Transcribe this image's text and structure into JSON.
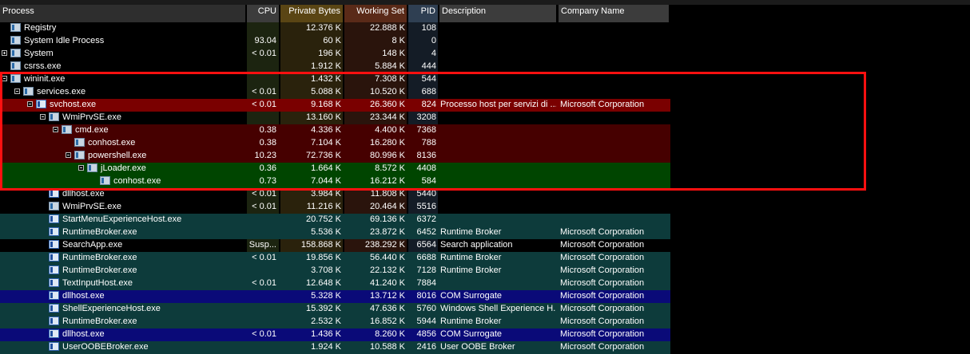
{
  "columns": {
    "process": "Process",
    "cpu": "CPU",
    "private_bytes": "Private Bytes",
    "working_set": "Working Set",
    "pid": "PID",
    "description": "Description",
    "company": "Company Name"
  },
  "colors": {
    "highlight_red": "#7a0000",
    "suspended_darkred": "#460000",
    "new_green": "#004500",
    "immersive_teal": "#0d3b3b",
    "service_blue": "#0a0a78",
    "selection_border": "#ff1010"
  },
  "rows": [
    {
      "name": "Registry",
      "cpu": "",
      "private_bytes": "12.376 K",
      "working_set": "22.888 K",
      "pid": "108",
      "description": "",
      "company": "",
      "depth": 0,
      "expander": "none",
      "bg": "none",
      "icon": "process-icon"
    },
    {
      "name": "System Idle Process",
      "cpu": "93.04",
      "private_bytes": "60 K",
      "working_set": "8 K",
      "pid": "0",
      "description": "",
      "company": "",
      "depth": 0,
      "expander": "none",
      "bg": "none",
      "icon": "process-icon"
    },
    {
      "name": "System",
      "cpu": "< 0.01",
      "private_bytes": "196 K",
      "working_set": "148 K",
      "pid": "4",
      "description": "",
      "company": "",
      "depth": 0,
      "expander": "plus",
      "bg": "none",
      "icon": "process-icon"
    },
    {
      "name": "csrss.exe",
      "cpu": "",
      "private_bytes": "1.912 K",
      "working_set": "5.884 K",
      "pid": "444",
      "description": "",
      "company": "",
      "depth": 0,
      "expander": "none",
      "bg": "none",
      "icon": "process-icon"
    },
    {
      "name": "wininit.exe",
      "cpu": "",
      "private_bytes": "1.432 K",
      "working_set": "7.308 K",
      "pid": "544",
      "description": "",
      "company": "",
      "depth": 0,
      "expander": "minus",
      "bg": "none",
      "icon": "process-icon"
    },
    {
      "name": "services.exe",
      "cpu": "< 0.01",
      "private_bytes": "5.088 K",
      "working_set": "10.520 K",
      "pid": "688",
      "description": "",
      "company": "",
      "depth": 1,
      "expander": "minus",
      "bg": "none",
      "icon": "process-icon"
    },
    {
      "name": "svchost.exe",
      "cpu": "< 0.01",
      "private_bytes": "9.168 K",
      "working_set": "26.360 K",
      "pid": "824",
      "description": "Processo host per servizi di ...",
      "company": "Microsoft Corporation",
      "depth": 2,
      "expander": "minus",
      "bg": "red",
      "icon": "service-icon"
    },
    {
      "name": "WmiPrvSE.exe",
      "cpu": "",
      "private_bytes": "13.160 K",
      "working_set": "23.344 K",
      "pid": "3208",
      "description": "",
      "company": "",
      "depth": 3,
      "expander": "minus",
      "bg": "none",
      "icon": "process-icon"
    },
    {
      "name": "cmd.exe",
      "cpu": "0.38",
      "private_bytes": "4.336 K",
      "working_set": "4.400 K",
      "pid": "7368",
      "description": "",
      "company": "",
      "depth": 4,
      "expander": "minus",
      "bg": "darkred",
      "icon": "process-icon"
    },
    {
      "name": "conhost.exe",
      "cpu": "0.38",
      "private_bytes": "7.104 K",
      "working_set": "16.280 K",
      "pid": "788",
      "description": "",
      "company": "",
      "depth": 5,
      "expander": "none",
      "bg": "darkred",
      "icon": "process-icon"
    },
    {
      "name": "powershell.exe",
      "cpu": "10.23",
      "private_bytes": "72.736 K",
      "working_set": "80.996 K",
      "pid": "8136",
      "description": "",
      "company": "",
      "depth": 5,
      "expander": "minus",
      "bg": "darkred",
      "icon": "process-icon"
    },
    {
      "name": "jLoader.exe",
      "cpu": "0.36",
      "private_bytes": "1.664 K",
      "working_set": "8.572 K",
      "pid": "4408",
      "description": "",
      "company": "",
      "depth": 6,
      "expander": "minus",
      "bg": "green",
      "icon": "process-icon"
    },
    {
      "name": "conhost.exe",
      "cpu": "0.73",
      "private_bytes": "7.044 K",
      "working_set": "16.212 K",
      "pid": "584",
      "description": "",
      "company": "",
      "depth": 7,
      "expander": "none",
      "bg": "green",
      "icon": "process-icon"
    },
    {
      "name": "dllhost.exe",
      "cpu": "< 0.01",
      "private_bytes": "3.984 K",
      "working_set": "11.808 K",
      "pid": "5440",
      "description": "",
      "company": "",
      "depth": 3,
      "expander": "none",
      "bg": "none",
      "icon": "service-icon"
    },
    {
      "name": "WmiPrvSE.exe",
      "cpu": "< 0.01",
      "private_bytes": "11.216 K",
      "working_set": "20.464 K",
      "pid": "5516",
      "description": "",
      "company": "",
      "depth": 3,
      "expander": "none",
      "bg": "none",
      "icon": "process-icon"
    },
    {
      "name": "StartMenuExperienceHost.exe",
      "cpu": "",
      "private_bytes": "20.752 K",
      "working_set": "69.136 K",
      "pid": "6372",
      "description": "",
      "company": "",
      "depth": 3,
      "expander": "none",
      "bg": "teal",
      "icon": "service-icon"
    },
    {
      "name": "RuntimeBroker.exe",
      "cpu": "",
      "private_bytes": "5.536 K",
      "working_set": "23.872 K",
      "pid": "6452",
      "description": "Runtime Broker",
      "company": "Microsoft Corporation",
      "depth": 3,
      "expander": "none",
      "bg": "teal",
      "icon": "service-icon"
    },
    {
      "name": "SearchApp.exe",
      "cpu": "Susp...",
      "private_bytes": "158.868 K",
      "working_set": "238.292 K",
      "pid": "6564",
      "description": "Search application",
      "company": "Microsoft Corporation",
      "depth": 3,
      "expander": "none",
      "bg": "none",
      "icon": "service-icon"
    },
    {
      "name": "RuntimeBroker.exe",
      "cpu": "< 0.01",
      "private_bytes": "19.856 K",
      "working_set": "56.440 K",
      "pid": "6688",
      "description": "Runtime Broker",
      "company": "Microsoft Corporation",
      "depth": 3,
      "expander": "none",
      "bg": "teal",
      "icon": "service-icon"
    },
    {
      "name": "RuntimeBroker.exe",
      "cpu": "",
      "private_bytes": "3.708 K",
      "working_set": "22.132 K",
      "pid": "7128",
      "description": "Runtime Broker",
      "company": "Microsoft Corporation",
      "depth": 3,
      "expander": "none",
      "bg": "teal",
      "icon": "service-icon"
    },
    {
      "name": "TextInputHost.exe",
      "cpu": "< 0.01",
      "private_bytes": "12.648 K",
      "working_set": "41.240 K",
      "pid": "7884",
      "description": "",
      "company": "Microsoft Corporation",
      "depth": 3,
      "expander": "none",
      "bg": "teal",
      "icon": "service-icon"
    },
    {
      "name": "dllhost.exe",
      "cpu": "",
      "private_bytes": "5.328 K",
      "working_set": "13.712 K",
      "pid": "8016",
      "description": "COM Surrogate",
      "company": "Microsoft Corporation",
      "depth": 3,
      "expander": "none",
      "bg": "blue",
      "icon": "service-icon"
    },
    {
      "name": "ShellExperienceHost.exe",
      "cpu": "",
      "private_bytes": "15.392 K",
      "working_set": "47.636 K",
      "pid": "5760",
      "description": "Windows Shell Experience H...",
      "company": "Microsoft Corporation",
      "depth": 3,
      "expander": "none",
      "bg": "teal",
      "icon": "service-icon"
    },
    {
      "name": "RuntimeBroker.exe",
      "cpu": "",
      "private_bytes": "2.532 K",
      "working_set": "16.852 K",
      "pid": "5944",
      "description": "Runtime Broker",
      "company": "Microsoft Corporation",
      "depth": 3,
      "expander": "none",
      "bg": "teal",
      "icon": "service-icon"
    },
    {
      "name": "dllhost.exe",
      "cpu": "< 0.01",
      "private_bytes": "1.436 K",
      "working_set": "8.260 K",
      "pid": "4856",
      "description": "COM Surrogate",
      "company": "Microsoft Corporation",
      "depth": 3,
      "expander": "none",
      "bg": "blue",
      "icon": "service-icon"
    },
    {
      "name": "UserOOBEBroker.exe",
      "cpu": "",
      "private_bytes": "1.924 K",
      "working_set": "10.588 K",
      "pid": "2416",
      "description": "User OOBE Broker",
      "company": "Microsoft Corporation",
      "depth": 3,
      "expander": "none",
      "bg": "teal",
      "icon": "service-icon"
    }
  ]
}
